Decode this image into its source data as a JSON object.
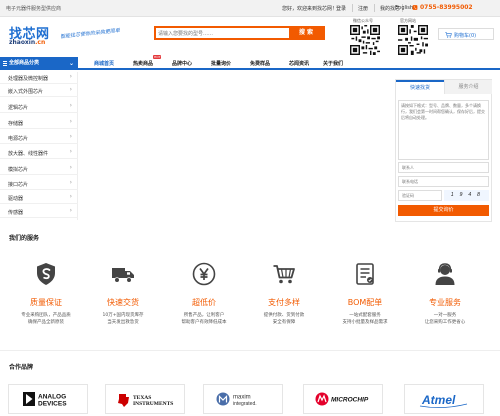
{
  "topbar": {
    "slogan": "电子元器件服务型供应商",
    "welcome": "您好，欢迎来到找芯网！",
    "links": [
      "登录",
      "注册",
      "我的找芯",
      "English"
    ],
    "phone": "0755-83995002"
  },
  "header": {
    "logo_cn": "找芯网",
    "logo_en_prefix": "zhaoxin",
    "logo_en_suffix": ".cn",
    "tagline": "智能找芯使你的采购更简单",
    "search_placeholder": "请输入您要找的型号……",
    "search_button": "搜 索",
    "qr1_label": "微信公众号",
    "qr2_label": "官方网站",
    "cart_label": "购物车(0)"
  },
  "nav": {
    "category_header": "全部商品分类",
    "items": [
      "商城首页",
      "热卖商品",
      "品牌中心",
      "批量询价",
      "免费样品",
      "芯闻资讯",
      "关于我们"
    ],
    "hot_badge": "HOT"
  },
  "sidebar": {
    "items": [
      "处理器及微控制器",
      "嵌入式外围芯片",
      "逻辑芯片",
      "存储器",
      "电源芯片",
      "放大器、线性器件",
      "模拟芯片",
      "接口芯片",
      "驱动器",
      "传感器"
    ]
  },
  "panel": {
    "tabs": [
      "快速找货",
      "服务介绍"
    ],
    "textarea_placeholder": "请按如下格式：型号、品牌、数量，多个请换行，我们会第一时间帮您确认，保存好后，提交后将自动处理。",
    "name_placeholder": "联系人",
    "contact_placeholder": "联系电话",
    "captcha_placeholder": "验证码",
    "captcha_text": "1 9 4 8",
    "submit": "提交询价"
  },
  "services": {
    "title": "我们的服务",
    "items": [
      {
        "icon": "shield-icon",
        "title": "质量保证",
        "d1": "专业采购团队，产品品质",
        "d2": "确保产品全新原装"
      },
      {
        "icon": "truck-icon",
        "title": "快速交货",
        "d1": "10万+国内现货库存",
        "d2": "当天发出救急货"
      },
      {
        "icon": "yen-coin-icon",
        "title": "超低价",
        "d1": "所售产品，让利客户",
        "d2": "帮助客户有效降低成本"
      },
      {
        "icon": "cart-icon",
        "title": "支付多样",
        "d1": "提供付款、货到付款",
        "d2": "安全有保障"
      },
      {
        "icon": "bom-document-icon",
        "title": "BOM配单",
        "d1": "一站式配套服务",
        "d2": "支持小批量及样品需求"
      },
      {
        "icon": "service-person-icon",
        "title": "专业服务",
        "d1": "一对一服务",
        "d2": "让您采购工作更省心"
      }
    ]
  },
  "brands": {
    "title": "合作品牌",
    "items": [
      "ANALOG DEVICES",
      "TEXAS INSTRUMENTS",
      "maxim integrated",
      "MICROCHIP",
      "Atmel"
    ]
  },
  "colors": {
    "brand_blue": "#1a67c7",
    "accent_orange": "#f25a00"
  }
}
